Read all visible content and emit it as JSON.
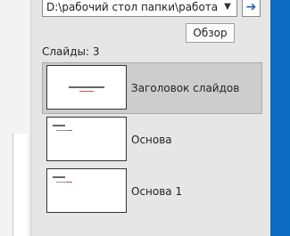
{
  "path_field": {
    "value": "D:\\рабочий стол папки\\работа\\За",
    "dropdown_icon": "chevron-down-icon"
  },
  "go_button": {
    "icon": "arrow-right-icon",
    "glyph": "➔"
  },
  "browse_button": {
    "label": "Обзор"
  },
  "slides_section": {
    "label": "Слайды: 3"
  },
  "slides": [
    {
      "label": "Заголовок слайдов",
      "selected": true
    },
    {
      "label": "Основа",
      "selected": false
    },
    {
      "label": "Основа 1",
      "selected": false
    }
  ],
  "colors": {
    "accent_stripe": "#0b6bc2",
    "selected_row": "#cdcdcd"
  }
}
